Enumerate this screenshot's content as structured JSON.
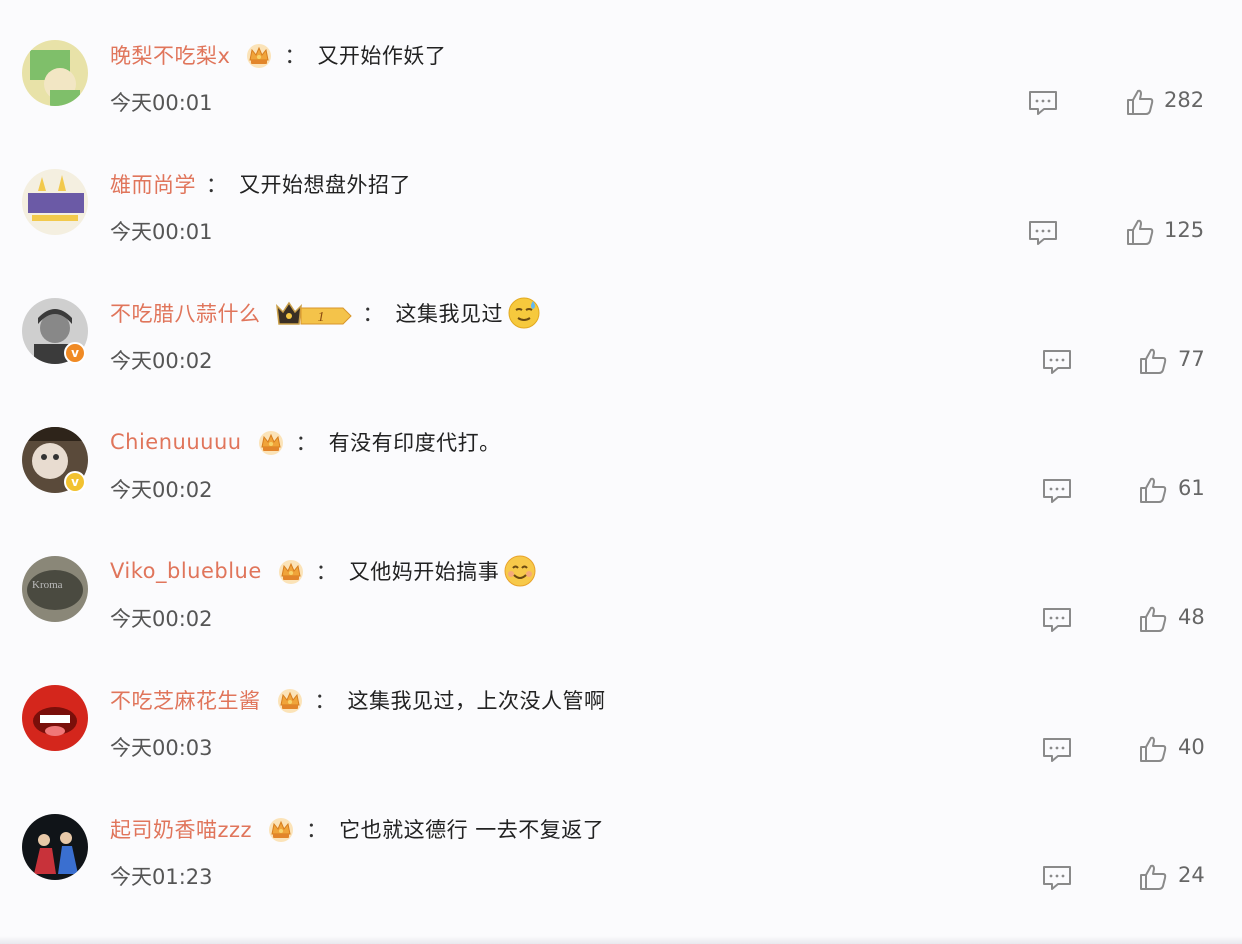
{
  "comments": [
    {
      "username": "晚梨不吃梨x",
      "badge": "crown",
      "text": "又开始作妖了",
      "time": "今天00:01",
      "likes": "282",
      "avatar_colors": [
        "#7fbf6a",
        "#e8e2a8"
      ],
      "verified": null
    },
    {
      "username": "雄而尚学",
      "badge": null,
      "text": "又开始想盘外招了",
      "time": "今天00:01",
      "likes": "125",
      "avatar_colors": [
        "#6b5aa6",
        "#f2c94c"
      ],
      "verified": null
    },
    {
      "username": "不吃腊八蒜什么",
      "badge": "level",
      "badge_level": "1",
      "text": "这集我见过",
      "emoji": "sweat-smile",
      "time": "今天00:02",
      "likes": "77",
      "avatar_colors": [
        "#3b3b3b",
        "#cfcfcf"
      ],
      "verified": "#f08a24"
    },
    {
      "username": "Chienuuuuu",
      "badge": "crown",
      "text": "有没有印度代打。",
      "time": "今天00:02",
      "likes": "61",
      "avatar_colors": [
        "#5a4a3a",
        "#e8dcd0"
      ],
      "verified": "#f2c230"
    },
    {
      "username": "Viko_blueblue",
      "badge": "crown",
      "text": "又他妈开始搞事",
      "emoji": "smile",
      "time": "今天00:02",
      "likes": "48",
      "avatar_colors": [
        "#4a4a40",
        "#8a8778"
      ],
      "verified": null
    },
    {
      "username": "不吃芝麻花生酱",
      "badge": "crown",
      "text": "这集我见过，上次没人管啊",
      "time": "今天00:03",
      "likes": "40",
      "avatar_colors": [
        "#d4261c",
        "#ffffff"
      ],
      "verified": null
    },
    {
      "username": "起司奶香喵zzz",
      "badge": "crown",
      "text": "它也就这德行 一去不复返了",
      "time": "今天01:23",
      "likes": "24",
      "avatar_colors": [
        "#101418",
        "#c8323a"
      ],
      "verified": null
    }
  ],
  "colon": "：",
  "icons": {
    "reply": "comment-icon",
    "like": "thumbs-up-icon",
    "badge": "crown-badge-icon"
  },
  "colors": {
    "username": "#e0755b",
    "icon": "#8a8a8a"
  }
}
